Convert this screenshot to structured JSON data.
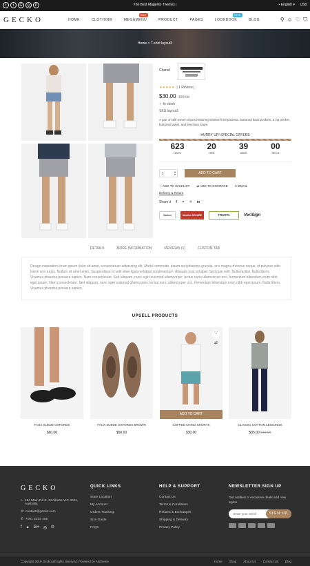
{
  "topbar": {
    "promo": "The Best Magento Themes |",
    "language": "English",
    "currency": "USD",
    "socials": [
      "f",
      "t",
      "G",
      "◎",
      "P"
    ]
  },
  "header": {
    "logo": "GECKO",
    "nav": [
      {
        "label": "HOME"
      },
      {
        "label": "CLOTHING"
      },
      {
        "label": "MEGAMENU",
        "badge": "HOT",
        "badge_color": "#e55039"
      },
      {
        "label": "PRODUCT"
      },
      {
        "label": "PAGES"
      },
      {
        "label": "LOOKBOOK",
        "badge": "NEW",
        "badge_color": "#3cb4d6"
      },
      {
        "label": "BLOG"
      }
    ]
  },
  "breadcrumb": {
    "home": "Home",
    "sep": ">",
    "current": "T-shirt layout3"
  },
  "product": {
    "brand": "Chanel",
    "review_text": "| 1 Review |",
    "rating": 4.5,
    "price": "$30.00",
    "old_price": "$34.00",
    "stock": "In stock",
    "sku": "SKU:layout3",
    "description": "A pair of twill woven shorts featuring slanted front pockets, buttoned back pockets, a zip pocket, buttoned waist, and keychain loops.",
    "hurry": "HURRY UP! SPECIAL OFFERS",
    "countdown": [
      {
        "value": "623",
        "label": "DAYS"
      },
      {
        "value": "20",
        "label": "HRS"
      },
      {
        "value": "39",
        "label": "MINS"
      },
      {
        "value": "00",
        "label": "SECS"
      }
    ],
    "qty": "1",
    "add_to_cart": "ADD TO CART",
    "wishlist": "ADD TO WISHLIST",
    "compare": "ADD TO COMPARE",
    "email": "EMAIL",
    "delivery": "Delivery & Return",
    "share": "Share it",
    "badges": [
      "Norton",
      "McAfee SECURE",
      "TRUSTe",
      "VeriSign"
    ]
  },
  "tabs": [
    "DETAILS",
    "MORE INFORMATION",
    "REVIEWS (1)",
    "CUSTOM TAB"
  ],
  "details_text": "Design inspiration lorum ipsum dolor sit amet, consectetuer adipiscing elit. Morbi commodo, ipsum sed pharetra gravida, orci magna rhoncus neque, id pulvinar odio lorem non turpis. Nullam sit amet enim. Suspendisse id velit vitae ligula volutpat condimentum. Aliquam erat volutpat. Sed quis velit. Nulla facilisi. Nulla libero. Vivamus pharetra posuere sapien. Nam consectetuer. Sed aliquam, nunc eget euismod ullamcorper, lectus nunc ullamcorper orci, fermentum bibendum enim nibh eget ipsum. Nam consectetuer. Sed aliquam, nunc eget euismod ullamcorper, lectus nunc ullamcorper orci, fermentum bibendum enim nibh eget ipsum. Nulla libero. Vivamus pharetra posuere sapien.",
  "upsell": {
    "title": "UPSELL PRODUCTS",
    "products": [
      {
        "name": "FAUX SUEDE OXFORDS",
        "price": "$60.00",
        "old": ""
      },
      {
        "name": "FAUX SUEDE OXFORDS BROWN",
        "price": "$50.00",
        "old": ""
      },
      {
        "name": "CUFFED CHINO SHORTS",
        "price": "$30.00",
        "old": "",
        "button": "ADD TO CART"
      },
      {
        "name": "CLASSIC COTTON LEGGINGS",
        "price": "$35.00",
        "old": "$40.00"
      }
    ]
  },
  "footer": {
    "logo": "GECKO",
    "address": "184 Main Rd E, St Albans VIC 3021, Australia",
    "email": "contact@gecko.com",
    "phone": "+001 2233 456",
    "quick_title": "QUICK LINKS",
    "quick": [
      "Store Location",
      "My Account",
      "Orders Tracking",
      "Size Guide",
      "FAQs"
    ],
    "help_title": "HELP & SUPPORT",
    "help": [
      "Contact Us",
      "Terms & Conditions",
      "Returns & Exchanges",
      "Shipping & Delivery",
      "Privacy Policy"
    ],
    "news_title": "NEWSLETTER SIGN UP",
    "news_text": "Get notified of exclusive deals and new styles",
    "news_placeholder": "Enter your email",
    "news_button": "SIGN UP",
    "copyright": "Copyright 2019 Gecko all rights reserved. Powered by Alotheme",
    "bottom_links": [
      "Home",
      "Shop",
      "About Us",
      "Contact Us",
      "Blog"
    ]
  },
  "colors": {
    "accent": "#a7845e",
    "dark": "#2f2f2f"
  }
}
